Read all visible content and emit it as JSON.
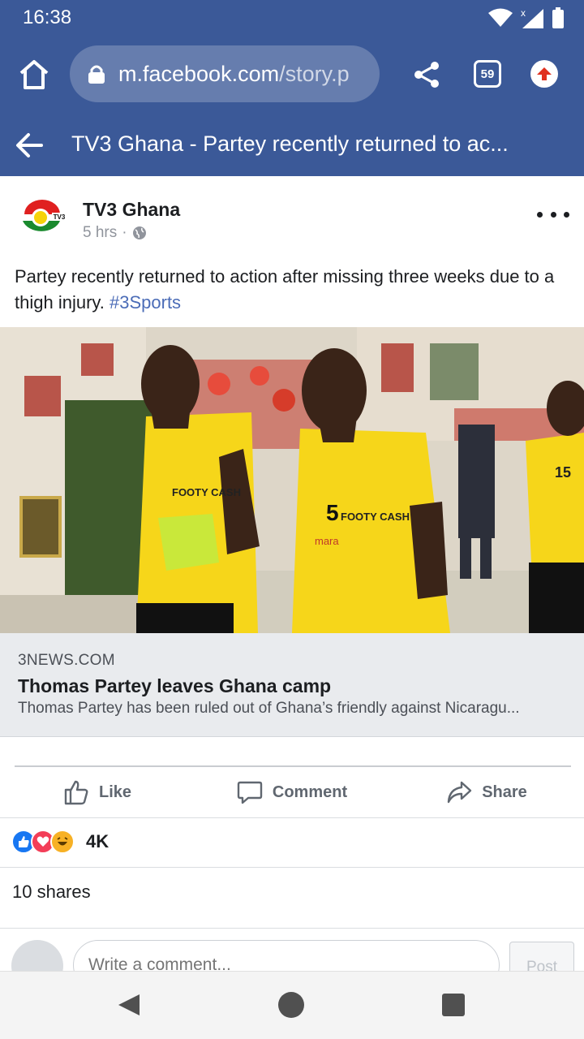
{
  "status_bar": {
    "time": "16:38"
  },
  "browser": {
    "url_host": "m.facebook.com",
    "url_path": "/story.p",
    "tab_count": "59"
  },
  "header": {
    "title": "TV3 Ghana - Partey recently returned to ac..."
  },
  "post": {
    "page_name": "TV3 Ghana",
    "timestamp": "5 hrs",
    "separator": "·",
    "avatar_label": "TV3",
    "text": "Partey recently returned to action after missing three weeks due to a thigh injury.",
    "hashtag": "#3Sports",
    "photo": {
      "shirt_text_1": "FOOTY CASH",
      "shirt_text_2": "FOOTY CASH",
      "shirt_number": "5",
      "sponsor": "mara",
      "back_number": "15"
    },
    "link": {
      "domain": "3NEWS.COM",
      "title": "Thomas Partey leaves Ghana camp",
      "description": "Thomas Partey has been ruled out of Ghana’s friendly against Nicaragu..."
    }
  },
  "actions": {
    "like": "Like",
    "comment": "Comment",
    "share": "Share"
  },
  "engagement": {
    "reaction_count": "4K",
    "shares": "10 shares"
  },
  "composer": {
    "placeholder": "Write a comment...",
    "post_label": "Post"
  },
  "colors": {
    "brand": "#3b5998",
    "link_bg": "#e9ebee",
    "hashtag": "#4b6cb7",
    "like_blue": "#1877f2",
    "love_red": "#f33e58",
    "haha_yellow": "#f7b125"
  }
}
